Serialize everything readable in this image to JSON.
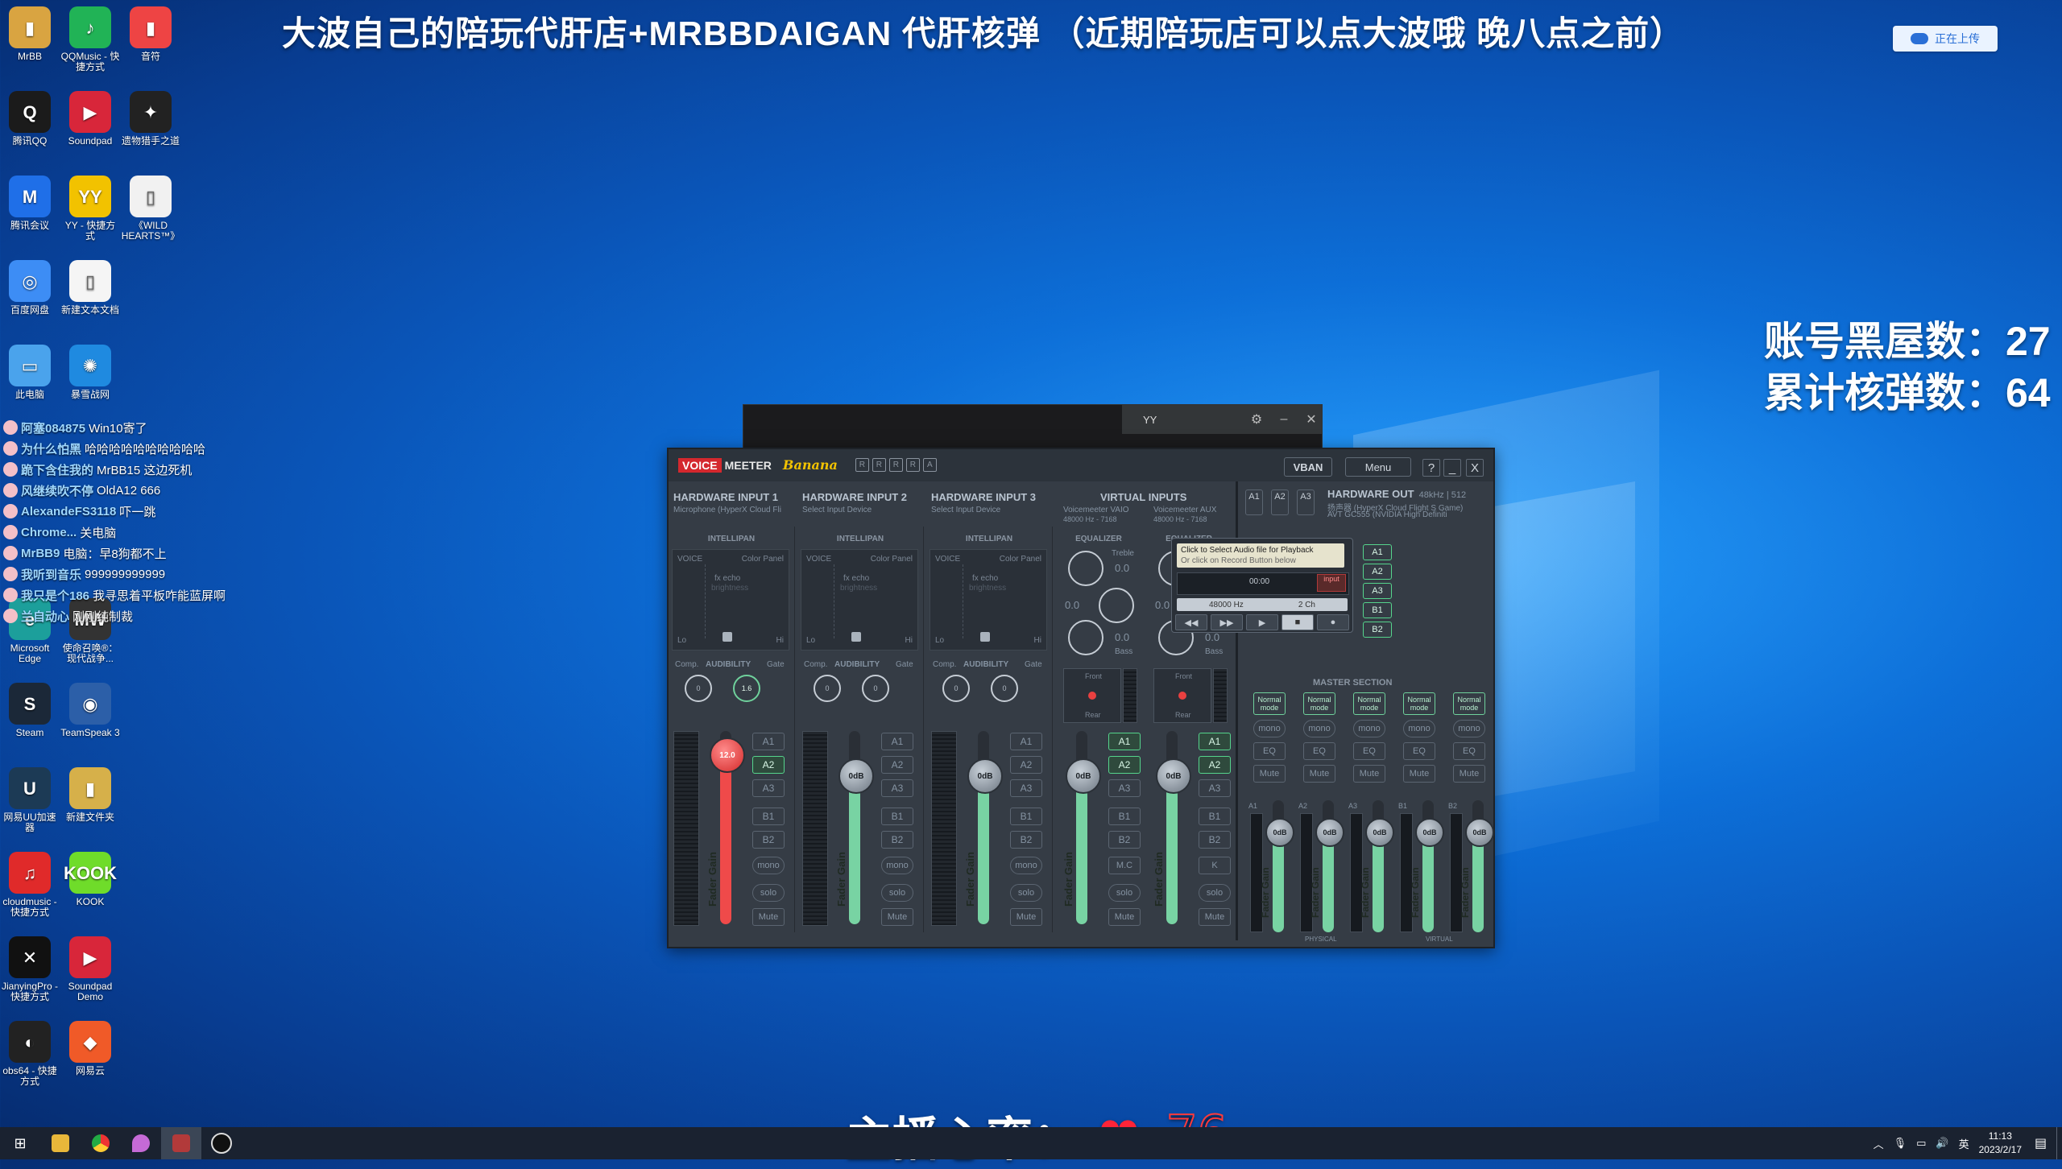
{
  "overlay": {
    "banner": "大波自己的陪玩代肝店+MRBBDAIGAN 代肝核弹 （近期陪玩店可以点大波哦 晚八点之前）",
    "upload_label": "正在上传",
    "stat1": "账号黑屋数：27",
    "stat2": "累计核弹数：64",
    "heart_label": "主播心率：",
    "heart_value": "76"
  },
  "desktop_icons": [
    {
      "label": "MrBB",
      "color": "#d9a441",
      "glyph": "▮"
    },
    {
      "label": "QQMusic - 快捷方式",
      "color": "#21b356",
      "glyph": "♪"
    },
    {
      "label": "音符",
      "color": "#e44",
      "glyph": "▮"
    },
    {
      "label": "腾讯QQ",
      "color": "#1b1b1b",
      "glyph": "Q"
    },
    {
      "label": "Soundpad",
      "color": "#d8263a",
      "glyph": "▶"
    },
    {
      "label": "遗物猎手之道",
      "color": "#222",
      "glyph": "✦"
    },
    {
      "label": "腾讯会议",
      "color": "#1f6fe8",
      "glyph": "M"
    },
    {
      "label": "YY - 快捷方式",
      "color": "#f2c200",
      "glyph": "YY"
    },
    {
      "label": "《WILD HEARTS™》",
      "color": "#f1f1f1",
      "glyph": "▯"
    },
    {
      "label": "百度网盘",
      "color": "#3d8df5",
      "glyph": "◎"
    },
    {
      "label": "新建文本文档",
      "color": "#f5f5f5",
      "glyph": "▯"
    },
    {
      "label": "此电脑",
      "color": "#4aa3ec",
      "glyph": "▭"
    },
    {
      "label": "暴雪战网",
      "color": "#1f8ae0",
      "glyph": "✺"
    },
    {
      "label": "Microsoft Edge",
      "color": "#1c9f9b",
      "glyph": "e"
    },
    {
      "label": "使命召唤®：现代战争...",
      "color": "#333",
      "glyph": "MW"
    },
    {
      "label": "Steam",
      "color": "#1b2838",
      "glyph": "S"
    },
    {
      "label": "TeamSpeak 3",
      "color": "#2c5fa8",
      "glyph": "◉"
    },
    {
      "label": "网易UU加速器",
      "color": "#1c3a55",
      "glyph": "U"
    },
    {
      "label": "新建文件夹",
      "color": "#d6b04a",
      "glyph": "▮"
    },
    {
      "label": "cloudmusic - 快捷方式",
      "color": "#e02a2a",
      "glyph": "♫"
    },
    {
      "label": "KOOK",
      "color": "#6fdc2a",
      "glyph": "KOOK"
    },
    {
      "label": "JianyingPro - 快捷方式",
      "color": "#111",
      "glyph": "✕"
    },
    {
      "label": "Soundpad Demo",
      "color": "#d8263a",
      "glyph": "▶"
    },
    {
      "label": "obs64 - 快捷方式",
      "color": "#222",
      "glyph": "◐"
    },
    {
      "label": "网易云",
      "color": "#f05a28",
      "glyph": "◆"
    }
  ],
  "chat": [
    {
      "user": "阿塞084875",
      "msg": "Win10寄了"
    },
    {
      "user": "为什么怕黑",
      "msg": "哈哈哈哈哈哈哈哈哈哈"
    },
    {
      "user": "跪下含住我的",
      "msg": "MrBB15 这边死机",
      "tag": true
    },
    {
      "user": "风继续吹不停",
      "msg": "OldA12 666",
      "tag": true
    },
    {
      "user": "AlexandeFS3118",
      "msg": "吓一跳"
    },
    {
      "user": "Chrome...",
      "msg": "关电脑"
    },
    {
      "user": "MrBB9",
      "msg": "电脑：早8狗都不上"
    },
    {
      "user": "我听到音乐",
      "msg": "999999999999"
    },
    {
      "user": "我只是个186",
      "msg": "我寻思着平板咋能蓝屏啊"
    },
    {
      "user": "兰自动心",
      "msg": "刚刚纯制裁"
    }
  ],
  "yy": {
    "title": "YY",
    "btn_settings": "⚙",
    "btn_min": "–",
    "btn_close": "✕"
  },
  "vm": {
    "logo_voice": "VOICE",
    "logo_meeter": "MEETER",
    "logo_edition": "Banana",
    "logo_r": [
      "R",
      "R",
      "R",
      "R",
      "A"
    ],
    "vban": "VBAN",
    "menu": "Menu",
    "help": "?",
    "min": "_",
    "close": "X",
    "hw_inputs": [
      {
        "title": "HARDWARE INPUT  1",
        "sub": "Microphone (HyperX Cloud Fli",
        "gain": "12.0",
        "red": true,
        "routes": [
          "A1",
          "A2",
          "A3",
          "B1",
          "B2"
        ],
        "on": [
          "A2"
        ]
      },
      {
        "title": "HARDWARE INPUT  2",
        "sub": "Select Input Device",
        "gain": "0dB",
        "red": false,
        "routes": [
          "A1",
          "A2",
          "A3",
          "B1",
          "B2"
        ],
        "on": []
      },
      {
        "title": "HARDWARE INPUT  3",
        "sub": "Select Input Device",
        "gain": "0dB",
        "red": false,
        "routes": [
          "A1",
          "A2",
          "A3",
          "B1",
          "B2"
        ],
        "on": []
      }
    ],
    "intellipan": "INTELLIPAN",
    "voice": "VOICE",
    "color_panel": "Color Panel",
    "fx_echo": "fx echo",
    "brightness": "brightness",
    "lo": "Lo",
    "hi": "Hi",
    "audibility": "AUDIBILITY",
    "comp": "Comp.",
    "gate": "Gate",
    "knob_vals": [
      [
        "0",
        "1.6"
      ],
      [
        "0",
        "0"
      ],
      [
        "0",
        "0"
      ]
    ],
    "mono": "mono",
    "solo": "solo",
    "mute": "Mute",
    "fader_gain": "Fader Gain",
    "virtual_title": "VIRTUAL INPUTS",
    "virtual": [
      {
        "name": "Voicemeeter VAIO",
        "rate": "48000 Hz - 7168",
        "gain": "0dB",
        "extra": "M.C",
        "routes": [
          "A1",
          "A2",
          "A3",
          "B1",
          "B2"
        ],
        "on": [
          "A1",
          "A2"
        ]
      },
      {
        "name": "Voicemeeter AUX",
        "rate": "48000 Hz - 7168",
        "gain": "0dB",
        "extra": "K",
        "routes": [
          "A1",
          "A2",
          "A3",
          "B1",
          "B2"
        ],
        "on": [
          "A1",
          "A2"
        ]
      }
    ],
    "equalizer": "EQUALIZER",
    "treble": "Treble",
    "bass": "Bass",
    "eq_val": "0.0",
    "front": "Front",
    "rear": "Rear",
    "hw_out_title": "HARDWARE OUT",
    "hw_out_rate": "48kHz | 512",
    "hw_out_dev1": "扬声器 (HyperX Cloud Flight S Game)",
    "hw_out_dev2": "AVT GC555 (NVIDIA High Definiti",
    "a_btns": [
      "A1",
      "A2",
      "A3"
    ],
    "player_msg1": "Click to Select Audio file for Playback",
    "player_msg2": "Or click on Record Button below",
    "player_time": "00:00",
    "player_input": "input",
    "player_rate": "48000 Hz",
    "player_ch": "2 Ch",
    "player_ctrls": [
      "◀◀",
      "▶▶",
      "▶",
      "■",
      "●"
    ],
    "player_bus": [
      "A1",
      "A2",
      "A3",
      "B1",
      "B2"
    ],
    "master_title": "MASTER SECTION",
    "master": [
      {
        "label": "A1",
        "mode": "Normal mode",
        "gain": "0dB"
      },
      {
        "label": "A2",
        "mode": "Normal mode",
        "gain": "0dB"
      },
      {
        "label": "A3",
        "mode": "Normal mode",
        "gain": "0dB"
      },
      {
        "label": "B1",
        "mode": "Normal mode",
        "gain": "0dB"
      },
      {
        "label": "B2",
        "mode": "Normal mode",
        "gain": "0dB"
      }
    ],
    "eq": "EQ",
    "physical": "PHYSICAL",
    "virtual_lbl": "VIRTUAL"
  },
  "taskbar": {
    "tray_lang": "英",
    "time": "11:13",
    "date": "2023/2/17"
  }
}
